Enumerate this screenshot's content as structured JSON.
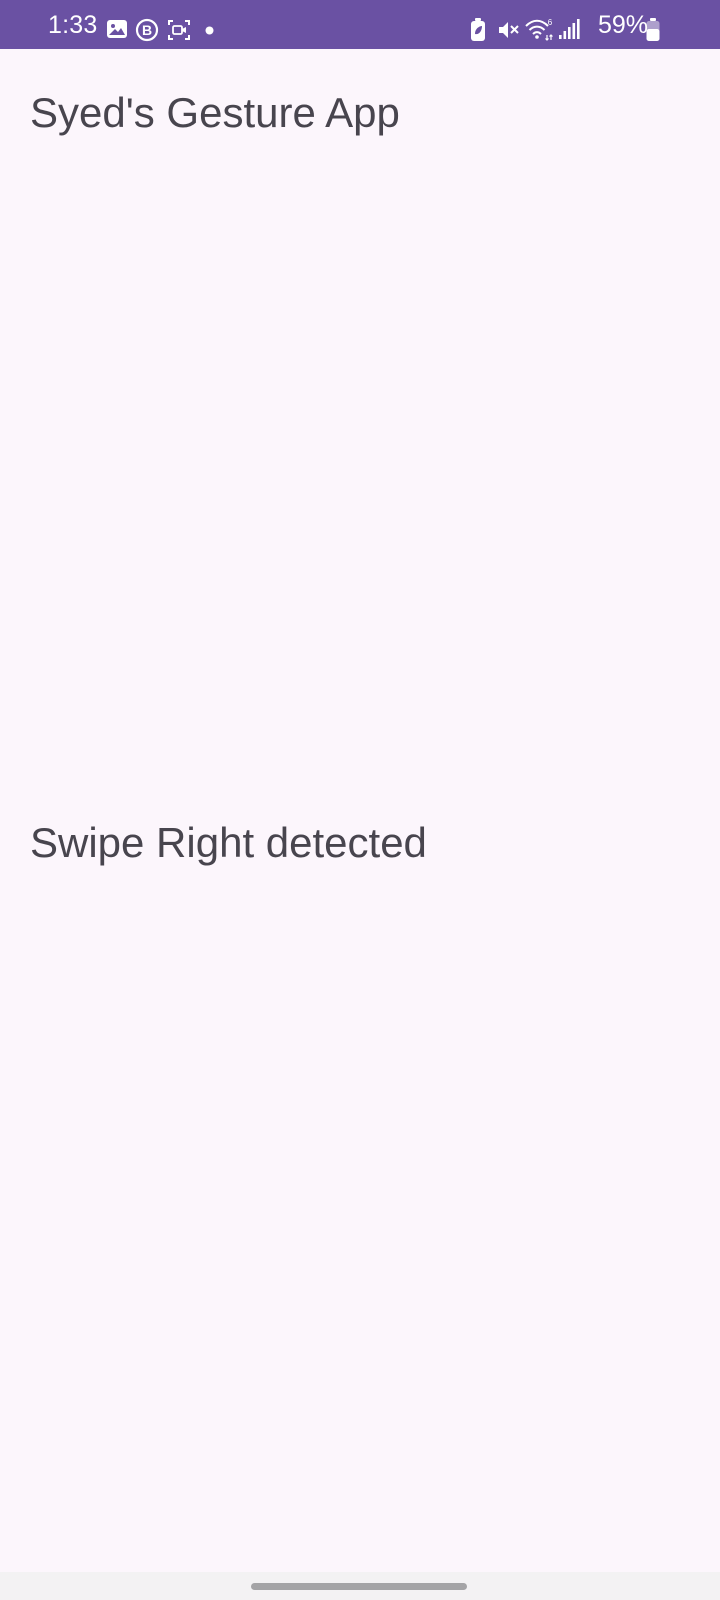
{
  "status_bar": {
    "time": "1:33",
    "battery_percent": "59%",
    "left_icons": [
      "gallery-icon",
      "business-b-icon",
      "screen-record-icon",
      "notification-dot-icon"
    ],
    "right_icons": [
      "battery-saver-icon",
      "mute-icon",
      "wifi-6-icon",
      "signal-icon",
      "battery-icon"
    ],
    "background_color": "#6a51a3"
  },
  "app": {
    "title": "Syed's Gesture App",
    "gesture_status": "Swipe Right detected",
    "background_color": "#fcf6fc",
    "text_color": "#48454e"
  },
  "navigation": {
    "type": "gesture-handle"
  }
}
